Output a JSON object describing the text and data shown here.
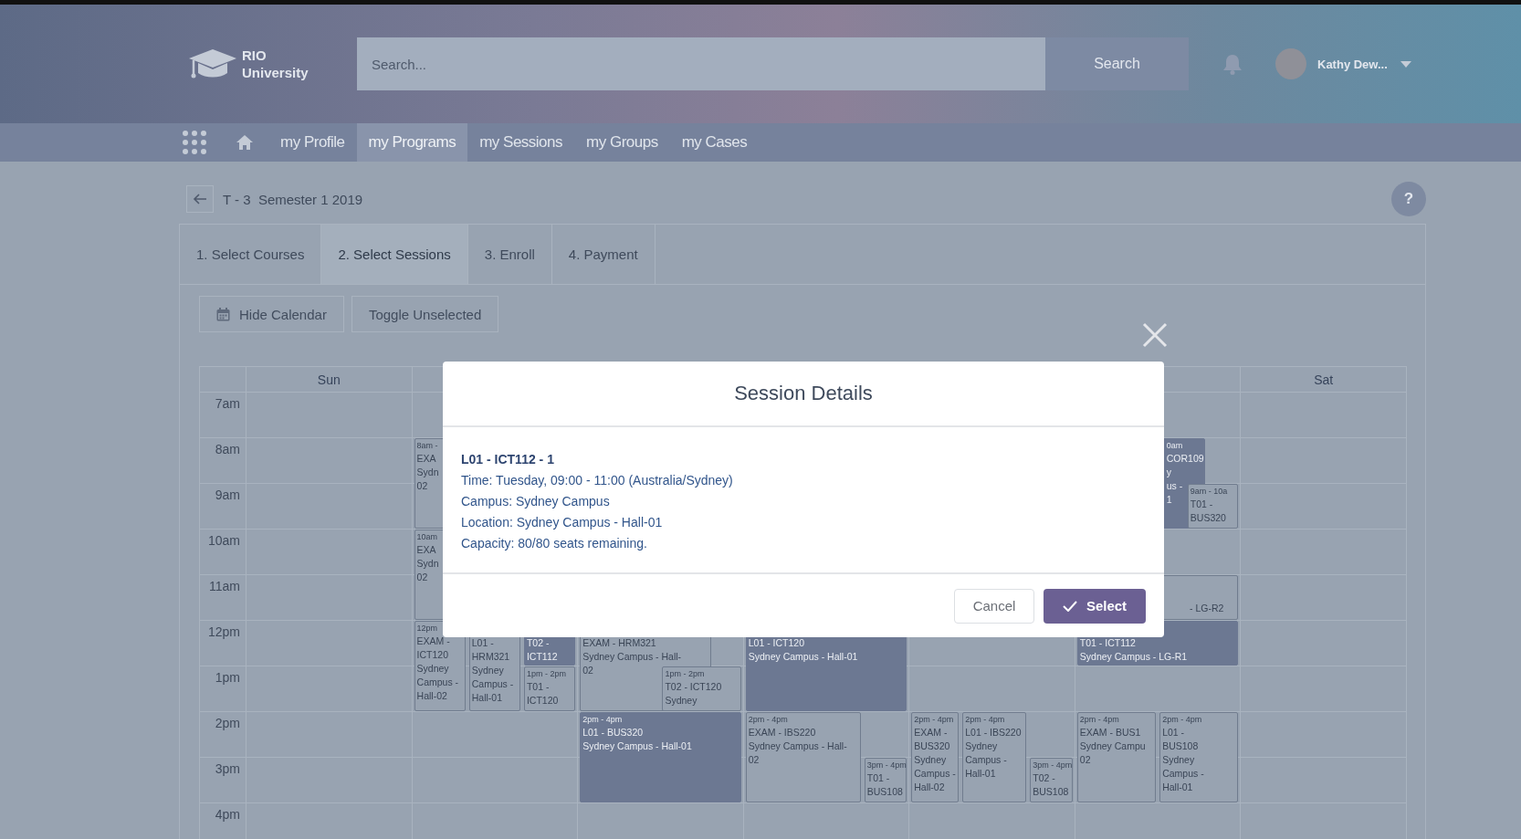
{
  "header": {
    "logo_lines": [
      "RIO",
      "University"
    ],
    "search": {
      "placeholder": "Search..."
    },
    "search_button": "Search",
    "user": {
      "name": "Kathy Dew..."
    }
  },
  "nav": [
    {
      "label": "my Profile",
      "selected": false
    },
    {
      "label": "my Programs",
      "selected": true
    },
    {
      "label": "my Sessions",
      "selected": false
    },
    {
      "label": "my Groups",
      "selected": false
    },
    {
      "label": "my Cases",
      "selected": false
    }
  ],
  "breadcrumb": {
    "title": "T - 3  Semester 1 2019"
  },
  "help_button": {
    "label": "?"
  },
  "steps": [
    {
      "label": "1. Select Courses",
      "selected": false
    },
    {
      "label": "2. Select Sessions",
      "selected": true
    },
    {
      "label": "3. Enroll",
      "selected": false
    },
    {
      "label": "4. Payment",
      "selected": false
    }
  ],
  "actions": [
    {
      "label": "Hide Calendar",
      "kind": "calendar"
    },
    {
      "label": "Toggle Unselected",
      "kind": "plain"
    }
  ],
  "calendar": {
    "days": [
      {
        "label": "Sun"
      },
      {
        "events": [
          {
            "selected": false,
            "kind": "full",
            "time": "8am -",
            "lines": [
              "EXA",
              "Sydn",
              "02"
            ]
          },
          {
            "selected": false,
            "kind": "full",
            "time": "10am",
            "lines": [
              "EXA",
              "Sydn",
              "02"
            ]
          },
          {
            "selected": false,
            "kind": "full",
            "time": "12pm",
            "lines": [
              "EXAM -",
              "ICT120",
              "Sydney",
              "Campus -",
              "Hall-02"
            ]
          },
          {
            "selected": false,
            "kind": "clipped",
            "lines": [
              "L01 -",
              "HRM321",
              "Sydney",
              "Campus -",
              "Hall-01"
            ]
          },
          {
            "selected": true,
            "kind": "clipped",
            "lines": [
              "T02 -",
              "ICT112"
            ]
          },
          {
            "selected": false,
            "kind": "full",
            "time": "1pm - 2pm",
            "lines": [
              "T01 -",
              "ICT120"
            ]
          }
        ]
      },
      {
        "events": [
          {
            "selected": false,
            "kind": "clipped",
            "lines": [
              "EXAM - HRM321",
              "Sydney Campus - Hall-",
              "02"
            ]
          },
          {
            "selected": false,
            "kind": "full",
            "time": "1pm - 2pm",
            "lines": [
              "T02 - ICT120",
              "Sydney"
            ]
          },
          {
            "selected": true,
            "kind": "full",
            "time": "2pm - 4pm",
            "lines": [
              "L01 - BUS320",
              "Sydney Campus - Hall-01"
            ]
          }
        ]
      },
      {
        "events": [
          {
            "selected": true,
            "kind": "clipped",
            "lines": [
              "L01 - ICT120",
              "Sydney Campus - Hall-01"
            ]
          },
          {
            "selected": false,
            "kind": "full",
            "time": "2pm - 4pm",
            "lines": [
              "EXAM - IBS220",
              "Sydney Campus - Hall-",
              "02"
            ]
          },
          {
            "selected": false,
            "kind": "full",
            "time": "3pm - 4pm",
            "lines": [
              "T01 -",
              "BUS108"
            ]
          }
        ]
      },
      {
        "events": [
          {
            "selected": false,
            "kind": "full",
            "time": "2pm - 4pm",
            "lines": [
              "EXAM -",
              "BUS320",
              "Sydney",
              "Campus -",
              "Hall-02"
            ]
          },
          {
            "selected": false,
            "kind": "full",
            "time": "2pm - 4pm",
            "lines": [
              "L01 - IBS220",
              "Sydney",
              "Campus -",
              "Hall-01"
            ]
          },
          {
            "selected": false,
            "kind": "full",
            "time": "3pm - 4pm",
            "lines": [
              "T02 -",
              "BUS108"
            ]
          }
        ]
      },
      {
        "events": [
          {
            "selected": true,
            "kind": "cut-left",
            "time": "0am",
            "lines": [
              "COR109",
              "y",
              "us -",
              "1"
            ]
          },
          {
            "selected": false,
            "kind": "full",
            "time": "9am - 10a",
            "lines": [
              "T01 -",
              "BUS320"
            ]
          },
          {
            "selected": false,
            "kind": "cut-left-bottom",
            "lines": [
              "- LG-R2"
            ]
          },
          {
            "selected": true,
            "kind": "clipped",
            "lines": [
              "T01 - ICT112",
              "Sydney Campus - LG-R1"
            ]
          },
          {
            "selected": false,
            "kind": "full",
            "time": "2pm - 4pm",
            "lines": [
              "EXAM - BUS1",
              "Sydney Campu",
              "02"
            ]
          },
          {
            "selected": false,
            "kind": "full",
            "time": "2pm - 4pm",
            "lines": [
              "L01 -",
              "BUS108",
              "Sydney",
              "Campus -",
              "Hall-01"
            ]
          }
        ]
      },
      {
        "label": "Sat"
      }
    ],
    "hours": [
      "7am",
      "8am",
      "9am",
      "10am",
      "11am",
      "12pm",
      "1pm",
      "2pm",
      "3pm",
      "4pm"
    ]
  },
  "modal": {
    "title": "Session Details",
    "heading": "L01 - ICT112 - 1",
    "details": [
      "Time: Tuesday, 09:00 - 11:00 (Australia/Sydney)",
      "Campus: Sydney Campus",
      "Location: Sydney Campus - Hall-01",
      "Capacity: 80/80 seats remaining."
    ],
    "cancel": "Cancel",
    "select": "Select"
  }
}
